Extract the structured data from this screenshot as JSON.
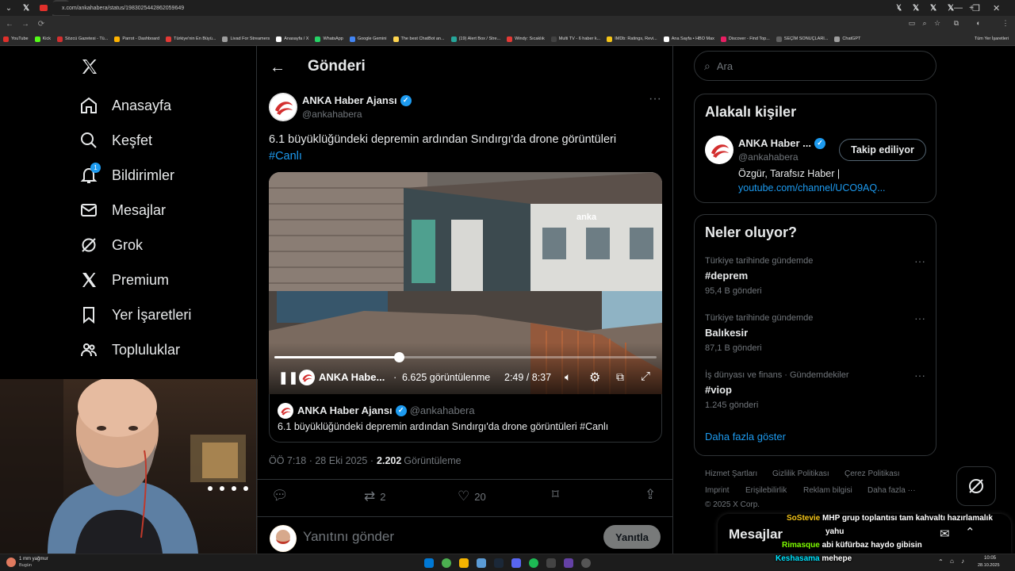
{
  "browser": {
    "url": "x.com/ankahabera/status/1983025442862059649",
    "tab_count": 54,
    "bookmarks": [
      {
        "label": "YouTube",
        "color": "#e0302b"
      },
      {
        "label": "Kick",
        "color": "#53fc18"
      },
      {
        "label": "Sözcü Gazetesi - Tü...",
        "color": "#d32f2f"
      },
      {
        "label": "Parrot - Dashboard",
        "color": "#ffb300"
      },
      {
        "label": "Türkiye'nin En Büyü...",
        "color": "#e53935"
      },
      {
        "label": "Livad For Streamers",
        "color": "#9e9e9e"
      },
      {
        "label": "Anasayfa / X",
        "color": "#ffffff"
      },
      {
        "label": "WhatsApp",
        "color": "#25d366"
      },
      {
        "label": "Google Gemini",
        "color": "#4285f4"
      },
      {
        "label": "The best ChatBot an...",
        "color": "#ffd54f"
      },
      {
        "label": "(19) Alert Box / Stre...",
        "color": "#26a69a"
      },
      {
        "label": "Windy: Sıcaklık",
        "color": "#e53935"
      },
      {
        "label": "Multi TV - 6 haber k...",
        "color": "#424242"
      },
      {
        "label": "IMDb: Ratings, Revi...",
        "color": "#f5c518"
      },
      {
        "label": "Ana Sayfa • HBO Max",
        "color": "#ffffff"
      },
      {
        "label": "Discover - Find Top...",
        "color": "#e91e63"
      },
      {
        "label": "SEÇİM SONUÇLARI...",
        "color": "#616161"
      },
      {
        "label": "ChatGPT",
        "color": "#9e9e9e"
      }
    ],
    "all_bookmarks": "Tüm Yer İşaretleri"
  },
  "nav": {
    "items": [
      {
        "label": "Anasayfa",
        "icon": "home-icon"
      },
      {
        "label": "Keşfet",
        "icon": "search-icon"
      },
      {
        "label": "Bildirimler",
        "icon": "bell-icon",
        "badge": "1"
      },
      {
        "label": "Mesajlar",
        "icon": "mail-icon"
      },
      {
        "label": "Grok",
        "icon": "grok-icon"
      },
      {
        "label": "Premium",
        "icon": "x-premium-icon"
      },
      {
        "label": "Yer İşaretleri",
        "icon": "bookmark-icon"
      },
      {
        "label": "Topluluklar",
        "icon": "communities-icon"
      }
    ]
  },
  "post": {
    "header_title": "Gönderi",
    "author_name": "ANKA Haber Ajansı",
    "author_handle": "@ankahabera",
    "text": "6.1 büyüklüğündeki depremin ardından Sındırgı'da drone görüntüleri",
    "hashtag": "#Canlı",
    "video": {
      "channel": "ANKA Habe...",
      "views": "6.625 görüntülenme",
      "time": "2:49 / 8:37",
      "progress": 0.326,
      "watermark": "anka"
    },
    "quote": {
      "author_name": "ANKA Haber Ajansı",
      "author_handle": "@ankahabera",
      "text": "6.1 büyüklüğündeki depremin ardından Sındırgı'da drone görüntüleri #Canlı"
    },
    "meta_time": "ÖÖ 7:18 · 28 Eki 2025 ·",
    "views_count": "2.202",
    "views_label": "Görüntüleme",
    "retweets": "2",
    "likes": "20",
    "reply_placeholder": "Yanıtını gönder",
    "reply_button": "Yanıtla"
  },
  "right": {
    "search_placeholder": "Ara",
    "related": {
      "title": "Alakalı kişiler",
      "name": "ANKA Haber ...",
      "handle": "@ankahabera",
      "follow_label": "Takip ediliyor",
      "bio": "Özgür, Tarafsız Haber |",
      "bio_link": "youtube.com/channel/UCO9AQ..."
    },
    "trends": {
      "title": "Neler oluyor?",
      "items": [
        {
          "context": "Türkiye tarihinde gündemde",
          "name": "#deprem",
          "count": "95,4 B gönderi"
        },
        {
          "context": "Türkiye tarihinde gündemde",
          "name": "Balıkesir",
          "count": "87,1 B gönderi"
        },
        {
          "context": "İş dünyası ve finans · Gündemdekiler",
          "name": "#viop",
          "count": "1.245 gönderi"
        }
      ],
      "show_more": "Daha fazla göster"
    },
    "footer": {
      "links": [
        "Hizmet Şartları",
        "Gizlilik Politikası",
        "Çerez Politikası",
        "Imprint",
        "Erişilebilirlik",
        "Reklam bilgisi",
        "Daha fazla ···"
      ],
      "copyright": "© 2025 X Corp."
    },
    "messages_label": "Mesajlar"
  },
  "stream_chat": [
    {
      "user": "SoStevie",
      "user_color": "#f5c518",
      "text": "MHP grup toplantısı tam kahvaltı hazırlamalık"
    },
    {
      "user": "",
      "user_color": "#ffffff",
      "text": "yahu"
    },
    {
      "user": "Rimasque",
      "user_color": "#7fff00",
      "text": "abi küfürbaz haydo gibisin"
    },
    {
      "user": "Keshasama",
      "user_color": "#00e5ff",
      "text": "mehepe"
    }
  ],
  "taskbar": {
    "weather": "1 mm yağmur",
    "weather_sub": "Bugün",
    "time": "10:05",
    "date": "28.10.2025"
  }
}
